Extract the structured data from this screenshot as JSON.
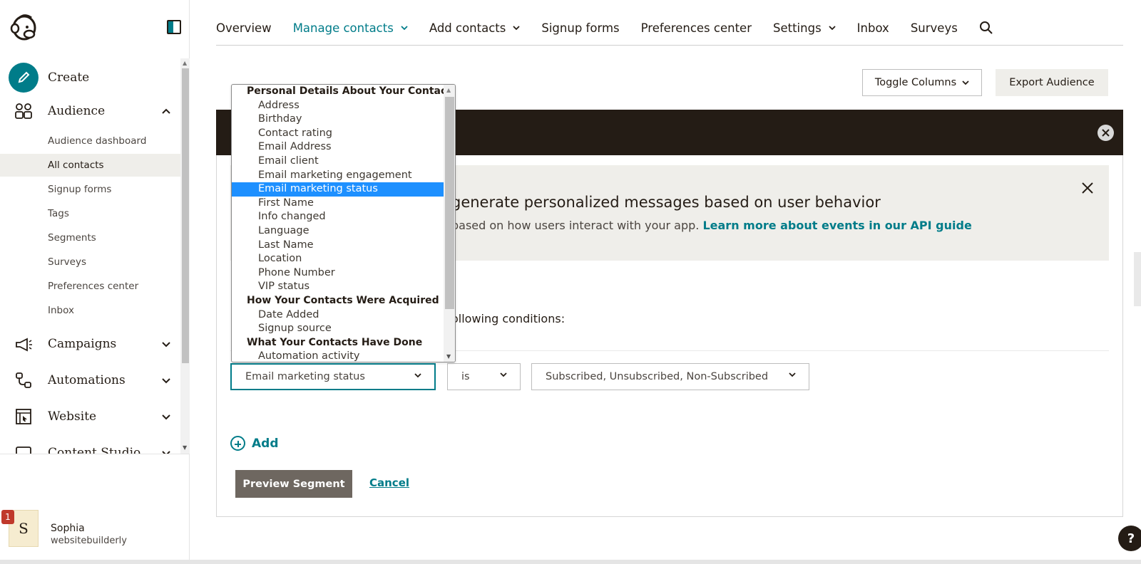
{
  "sidebar": {
    "create_label": "Create",
    "audience_label": "Audience",
    "audience_items": [
      {
        "label": "Audience dashboard"
      },
      {
        "label": "All contacts"
      },
      {
        "label": "Signup forms"
      },
      {
        "label": "Tags"
      },
      {
        "label": "Segments"
      },
      {
        "label": "Surveys"
      },
      {
        "label": "Preferences center"
      },
      {
        "label": "Inbox"
      }
    ],
    "campaigns_label": "Campaigns",
    "automations_label": "Automations",
    "website_label": "Website",
    "content_studio_label": "Content Studio",
    "user": {
      "initial": "S",
      "name": "Sophia",
      "org": "websitebuilderly",
      "notification_count": "1"
    }
  },
  "topnav": {
    "overview": "Overview",
    "manage_contacts": "Manage contacts",
    "add_contacts": "Add contacts",
    "signup_forms": "Signup forms",
    "preferences_center": "Preferences center",
    "settings": "Settings",
    "inbox": "Inbox",
    "surveys": "Surveys"
  },
  "toolbar": {
    "toggle_columns": "Toggle Columns",
    "export_audience": "Export Audience"
  },
  "info": {
    "title": "generate personalized messages based on user behavior",
    "body": "based on how users interact with your app.",
    "link": "Learn more about events in our API guide"
  },
  "segment": {
    "conditions_text": "ollowing conditions:",
    "field_value": "Email marketing status",
    "operator_value": "is",
    "value_value": "Subscribed, Unsubscribed, Non-Subscribed",
    "add_label": "Add",
    "preview_label": "Preview Segment",
    "cancel_label": "Cancel"
  },
  "dropdown": {
    "groups": [
      {
        "label": "Personal Details About Your Contacts",
        "options": [
          "Address",
          "Birthday",
          "Contact rating",
          "Email Address",
          "Email client",
          "Email marketing engagement",
          "Email marketing status",
          "First Name",
          "Info changed",
          "Language",
          "Last Name",
          "Location",
          "Phone Number",
          "VIP status"
        ]
      },
      {
        "label": "How Your Contacts Were Acquired",
        "options": [
          "Date Added",
          "Signup source"
        ]
      },
      {
        "label": "What Your Contacts Have Done",
        "options": [
          "Automation activity"
        ]
      }
    ],
    "selected": "Email marketing status"
  },
  "help_label": "?",
  "colors": {
    "accent": "#007c89",
    "dark_banner": "#241c15",
    "selected_option": "#1e90ff"
  }
}
